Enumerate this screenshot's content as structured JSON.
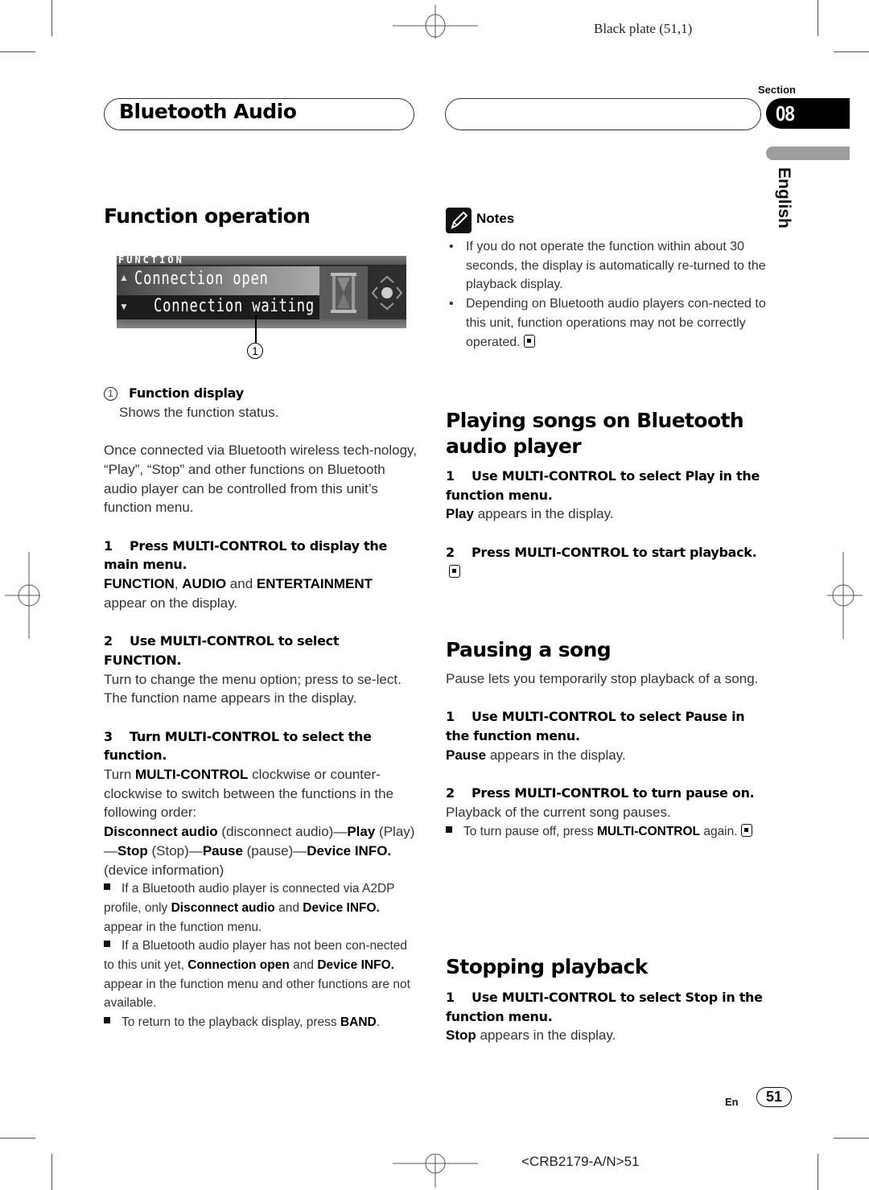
{
  "print_marks": {
    "plate_label": "Black plate (51,1)",
    "code_label": "<CRB2179-A/N>51"
  },
  "header": {
    "chapter_title": "Bluetooth Audio",
    "section_label": "Section",
    "section_number": "08",
    "language": "English"
  },
  "left": {
    "title": "Function operation",
    "display": {
      "header": "FUNCTION",
      "line1": "Connection open",
      "line2": "Connection waiting",
      "callout": "1"
    },
    "legend": {
      "num": "1",
      "title": "Function display",
      "desc": "Shows the function status."
    },
    "intro": "Once connected via Bluetooth wireless tech-nology, “Play”, “Stop” and other functions on Bluetooth audio player can be controlled from this unit’s function menu.",
    "step1": {
      "num": "1",
      "title": "Press MULTI-CONTROL to display the main menu.",
      "b1": "FUNCTION",
      "sep1": ", ",
      "b2": "AUDIO",
      "and": " and ",
      "b3": "ENTERTAINMENT",
      "tail": "appear on the display."
    },
    "step2": {
      "num": "2",
      "title": "Use MULTI-CONTROL to select FUNCTION.",
      "line1": "Turn to change the menu option; press to se-lect.",
      "line2": "The function name appears in the display."
    },
    "step3": {
      "num": "3",
      "title": "Turn MULTI-CONTROL to select the function.",
      "turn": "Turn ",
      "mc": "MULTI-CONTROL",
      "rest": " clockwise or counter-clockwise to switch between the functions in the following order:",
      "order": [
        {
          "bold": "Disconnect audio",
          "plain": " (disconnect audio)—"
        },
        {
          "bold": "Play",
          "plain": " (Play)—"
        },
        {
          "bold": "Stop",
          "plain": " (Stop)—"
        },
        {
          "bold": "Pause",
          "plain": " (pause)—"
        },
        {
          "bold": "Device INFO.",
          "plain": " (device information)"
        }
      ],
      "note1": {
        "a": "If a Bluetooth audio player is connected via A2DP profile, only ",
        "b1": "Disconnect audio",
        "c": " and ",
        "b2": "Device INFO.",
        "d": " appear in the function menu."
      },
      "note2": {
        "a": "If a Bluetooth audio player has not been con-nected to this unit yet, ",
        "b1": "Connection open",
        "c": " and ",
        "b2": "Device INFO.",
        "d": " appear in the function menu and other functions are not available."
      },
      "note3": {
        "a": "To return to the playback display, press ",
        "b1": "BAND",
        "d": "."
      }
    }
  },
  "right": {
    "notes_label": "Notes",
    "notes": [
      "If you do not operate the function within about 30 seconds, the display is automatically re-turned to the playback display.",
      "Depending on Bluetooth audio players con-nected to this unit, function operations may not be correctly operated."
    ],
    "playing": {
      "title": "Playing songs on Bluetooth audio player",
      "step1": {
        "num": "1",
        "title": "Use MULTI-CONTROL to select Play in the function menu.",
        "bold": "Play",
        "rest": " appears in the display."
      },
      "step2": {
        "num": "2",
        "title": "Press MULTI-CONTROL to start playback."
      }
    },
    "pausing": {
      "title": "Pausing a song",
      "intro": "Pause lets you temporarily stop playback of a song.",
      "step1": {
        "num": "1",
        "title": "Use MULTI-CONTROL to select Pause in the function menu.",
        "bold": "Pause",
        "rest": " appears in the display."
      },
      "step2": {
        "num": "2",
        "title": "Press MULTI-CONTROL to turn pause on.",
        "desc": "Playback of the current song pauses."
      },
      "tip": {
        "a": "To turn pause off, press ",
        "b": "MULTI-CONTROL",
        "c": " again."
      }
    },
    "stopping": {
      "title": "Stopping playback",
      "step1": {
        "num": "1",
        "title": "Use MULTI-CONTROL to select Stop in the function menu.",
        "bold": "Stop",
        "rest": " appears in the display."
      }
    }
  },
  "footer": {
    "lang_code": "En",
    "page_number": "51"
  }
}
